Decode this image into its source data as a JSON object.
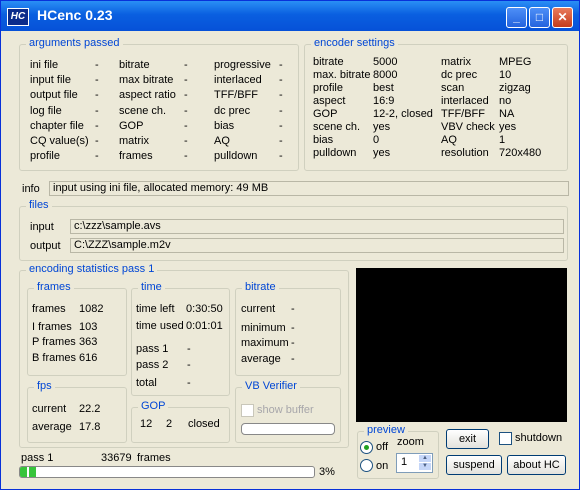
{
  "window": {
    "title": "HCenc 0.23",
    "icon_text": "HC",
    "minimize": "_",
    "maximize": "□",
    "close": "✕"
  },
  "arguments": {
    "title": "arguments passed",
    "col1": [
      "ini file",
      "input file",
      "output file",
      "log file",
      "chapter file",
      "CQ value(s)",
      "profile"
    ],
    "col2": [
      "bitrate",
      "max bitrate",
      "aspect ratio",
      "scene ch.",
      "GOP",
      "matrix",
      "frames"
    ],
    "col3": [
      "progressive",
      "interlaced",
      "TFF/BFF",
      "dc prec",
      "bias",
      "AQ",
      "pulldown"
    ],
    "dash": "-"
  },
  "encoder": {
    "title": "encoder settings",
    "left": [
      [
        "bitrate",
        "5000"
      ],
      [
        "max. bitrate",
        "8000"
      ],
      [
        "profile",
        "best"
      ],
      [
        "aspect",
        "16:9"
      ],
      [
        "GOP",
        "12-2, closed"
      ],
      [
        "scene ch.",
        "yes"
      ],
      [
        "bias",
        "0"
      ],
      [
        "pulldown",
        "yes"
      ]
    ],
    "right": [
      [
        "matrix",
        "MPEG"
      ],
      [
        "dc prec",
        "10"
      ],
      [
        "scan",
        "zigzag"
      ],
      [
        "interlaced",
        "no"
      ],
      [
        "TFF/BFF",
        "NA"
      ],
      [
        "VBV check",
        "yes"
      ],
      [
        "AQ",
        "1"
      ],
      [
        "resolution",
        "720x480"
      ]
    ]
  },
  "info": {
    "label": "info",
    "text": "input using ini file,  allocated memory:  49 MB"
  },
  "files": {
    "title": "files",
    "input_label": "input",
    "input_value": "c:\\zzz\\sample.avs",
    "output_label": "output",
    "output_value": "C:\\ZZZ\\sample.m2v"
  },
  "stats": {
    "title": "encoding statistics pass 1",
    "frames": {
      "title": "frames",
      "rows": [
        [
          "frames",
          "1082"
        ],
        [
          "I frames",
          "103"
        ],
        [
          "P frames",
          "363"
        ],
        [
          "B frames",
          "616"
        ]
      ]
    },
    "time": {
      "title": "time",
      "rows": [
        [
          "time left",
          "0:30:50"
        ],
        [
          "time used",
          "0:01:01"
        ]
      ],
      "pass1": "pass 1",
      "pass2": "pass 2",
      "total": "total",
      "dash": "-"
    },
    "bitrate": {
      "title": "bitrate",
      "rows": [
        "current",
        "minimum",
        "maximum",
        "average"
      ],
      "dash": "-"
    },
    "fps": {
      "title": "fps",
      "rows": [
        [
          "current",
          "22.2"
        ],
        [
          "average",
          "17.8"
        ]
      ]
    },
    "gop": {
      "title": "GOP",
      "n": "12",
      "m": "2",
      "type": "closed"
    },
    "vbv": {
      "title": "VB Verifier",
      "show_buffer": "show buffer"
    }
  },
  "progress": {
    "pass": "pass 1",
    "frames": "33679",
    "frames_label": "frames",
    "percent": 3,
    "percent_label": "3%"
  },
  "preview": {
    "title": "preview",
    "off": "off",
    "on": "on",
    "zoom": "zoom",
    "zoom_value": "1"
  },
  "buttons": {
    "exit": "exit",
    "shutdown": "shutdown",
    "suspend": "suspend",
    "about": "about  HC"
  }
}
